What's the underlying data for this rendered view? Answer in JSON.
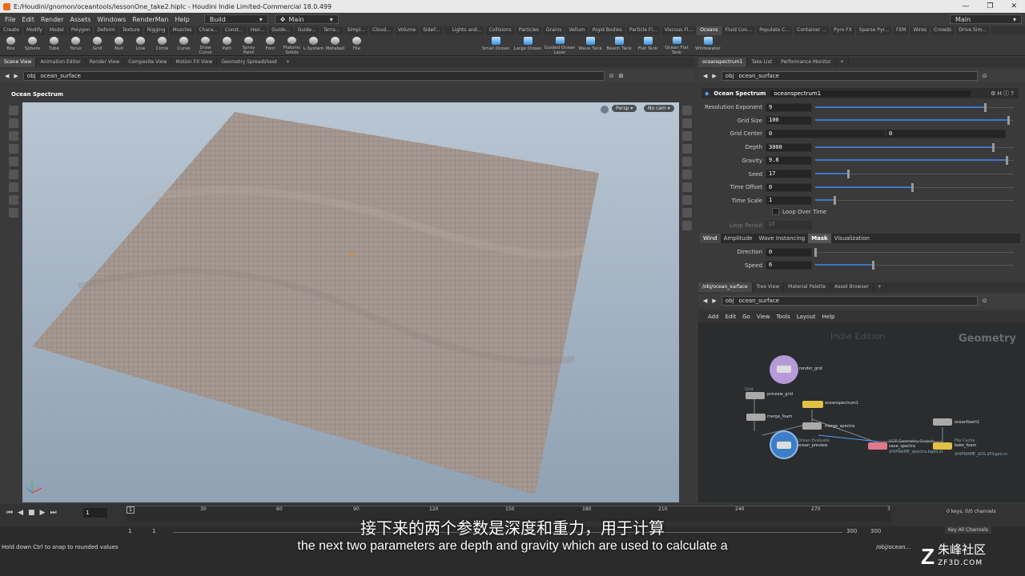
{
  "window": {
    "title": "E:/Houdini/gnomon/oceantools/lessonOne_take2.hiplc - Houdini Indie Limited-Commercial 18.0.499",
    "controls": [
      "—",
      "❐",
      "✕"
    ]
  },
  "menu": {
    "items": [
      "File",
      "Edit",
      "Render",
      "Assets",
      "Windows",
      "RenderMan",
      "Help"
    ],
    "desktop": "Build",
    "view": "Main",
    "right_desktop": "Main"
  },
  "shelf_tabs_left": [
    "Create",
    "Modify",
    "Model",
    "Polygon",
    "Deform",
    "Texture",
    "Rigging",
    "Muscles",
    "Chara...",
    "Const...",
    "Hair...",
    "Guide...",
    "Guide...",
    "Terra...",
    "Simpl...",
    "Cloud...",
    "Volume",
    "SideF..."
  ],
  "shelf_tabs_right": [
    "Lights and...",
    "Collisions",
    "Particles",
    "Grains",
    "Vellum",
    "Rigid Bodies",
    "Particle Fl...",
    "Viscous Fl...",
    "Oceans",
    "Fluid Con...",
    "Populate C...",
    "Container ...",
    "Pyro FX",
    "Sparse Pyr...",
    "FEM",
    "Wires",
    "Crowds",
    "Drive Sim..."
  ],
  "shelf_tools_left": [
    "Box",
    "Sphere",
    "Tube",
    "Torus",
    "Grid",
    "Null",
    "Line",
    "Circle",
    "Curve",
    "Draw Curve",
    "Path",
    "Spray Paint",
    "Font",
    "Platonic Solids",
    "L-System",
    "Metaball",
    "File"
  ],
  "shelf_tools_right": [
    "Small Ocean",
    "Large Ocean",
    "Guided Ocean Layer",
    "Wave Tank",
    "Beach Tank",
    "Flat Tank",
    "Ocean Flat Tank",
    "Whitewater"
  ],
  "left_tabs": [
    "Scene View",
    "Animation Editor",
    "Render View",
    "Composite View",
    "Motion FX View",
    "Geometry Spreadsheet"
  ],
  "left_path": {
    "root": "obj",
    "node": "ocean_surface"
  },
  "viewport": {
    "title": "Ocean Spectrum",
    "camera": "Persp ▾",
    "nocam": "No cam ▾"
  },
  "param_tabs": [
    "oceanspectrum1",
    "Take List",
    "Performance Monitor"
  ],
  "param_path": {
    "root": "obj",
    "node": "ocean_surface"
  },
  "param_header": {
    "type": "Ocean Spectrum",
    "name": "oceanspectrum1"
  },
  "params": [
    {
      "label": "Resolution Exponent",
      "value": "9",
      "slider": 0.88
    },
    {
      "label": "Grid Size",
      "value": "100",
      "slider": 1.0
    },
    {
      "label": "Grid Center",
      "value": "0",
      "value2": "0"
    },
    {
      "label": "Depth",
      "value": "3000",
      "slider": 0.92
    },
    {
      "label": "Gravity",
      "value": "9.8",
      "slider": 0.99
    },
    {
      "label": "Seed",
      "value": "17",
      "slider": 0.17
    },
    {
      "label": "Time Offset",
      "value": "0",
      "slider": 0.5
    },
    {
      "label": "Time Scale",
      "value": "1",
      "slider": 0.1
    }
  ],
  "loop_over_time": "Loop Over Time",
  "loop_period": {
    "label": "Loop Period",
    "value": "10"
  },
  "sub_tabs": [
    "Wind",
    "Amplitude",
    "Wave Instancing",
    "Mask",
    "Visualization"
  ],
  "wind_params": [
    {
      "label": "Direction",
      "value": "0",
      "slider": 0.0
    },
    {
      "label": "Speed",
      "value": "6",
      "slider": 0.3
    }
  ],
  "net_tabs": [
    "/obj/ocean_surface",
    "Tree View",
    "Material Palette",
    "Asset Browser"
  ],
  "net_path": {
    "root": "obj",
    "node": "ocean_surface"
  },
  "net_menu": [
    "Add",
    "Edit",
    "Go",
    "View",
    "Tools",
    "Layout",
    "Help"
  ],
  "net_watermark": "Indie Edition",
  "net_context": "Geometry",
  "nodes": [
    {
      "name": "render_grid",
      "sub": ""
    },
    {
      "name": "preview_grid",
      "sub": "Grid"
    },
    {
      "name": "oceanspectrum1",
      "sub": ""
    },
    {
      "name": "merge_foam",
      "sub": ""
    },
    {
      "name": "merge_spectra",
      "sub": ""
    },
    {
      "name": "oceanfoam1",
      "sub": ""
    },
    {
      "name": "ocean_preview",
      "sub": "Ocean Evaluate"
    },
    {
      "name": "save_spectra",
      "sub": "ROP Geometry Output"
    },
    {
      "name": "bake_foam",
      "sub": "File Cache"
    }
  ],
  "node_paths": [
    "$HIPNAME_spectra.bgeo.sc",
    "$HIPNAME_$OS.$F.bgeo.sc"
  ],
  "timeline": {
    "frame": "1",
    "ticks": [
      "1",
      "30",
      "60",
      "90",
      "120",
      "150",
      "180",
      "210",
      "240",
      "270",
      "3"
    ],
    "start": "1",
    "start2": "1",
    "end": "300",
    "end2": "300",
    "keys": "0 keys, 0/0 channels",
    "key_all": "Key All Channels"
  },
  "status": {
    "message": "Hold down Ctrl to snap to rounded values",
    "path": "/obj/ocean..."
  },
  "subtitles": {
    "cn": "接下来的两个参数是深度和重力，用于计算",
    "en": "the next two parameters are depth and gravity which are used to calculate a"
  },
  "logo": {
    "cn": "朱峰社区",
    "en": "ZF3D.COM",
    "mark": "Z"
  }
}
